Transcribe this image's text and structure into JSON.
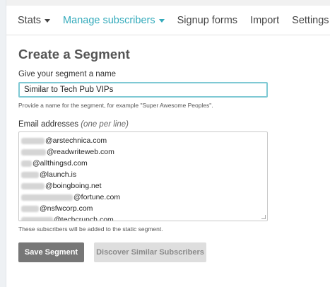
{
  "nav": {
    "items": [
      {
        "label": "Stats",
        "dropdown": true,
        "active": false
      },
      {
        "label": "Manage subscribers",
        "dropdown": true,
        "active": true
      },
      {
        "label": "Signup forms",
        "dropdown": false,
        "active": false
      },
      {
        "label": "Import",
        "dropdown": false,
        "active": false
      },
      {
        "label": "Settings",
        "dropdown": true,
        "active": false
      }
    ],
    "search_icon": "search-icon"
  },
  "form": {
    "title": "Create a Segment",
    "name_label": "Give your segment a name",
    "name_value": "Similar to Tech Pub VIPs",
    "name_help": "Provide a name for the segment, for example \"Super Awesome Peoples\".",
    "emails_label": "Email addresses",
    "emails_hint": "(one per line)",
    "emails": [
      "@arstechnica.com",
      "@readwriteweb.com",
      "@allthingsd.com",
      "@launch.is",
      "@boingboing.net",
      "@fortune.com",
      "@nsfwcorp.com",
      "@techcrunch.com"
    ],
    "emails_help": "These subscribers will be added to the static segment.",
    "save_label": "Save Segment",
    "discover_label": "Discover Similar Subscribers"
  },
  "colors": {
    "accent": "#33aabb",
    "input_focus": "#7fc9d4",
    "primary_button": "#777777",
    "secondary_button": "#dedede"
  }
}
